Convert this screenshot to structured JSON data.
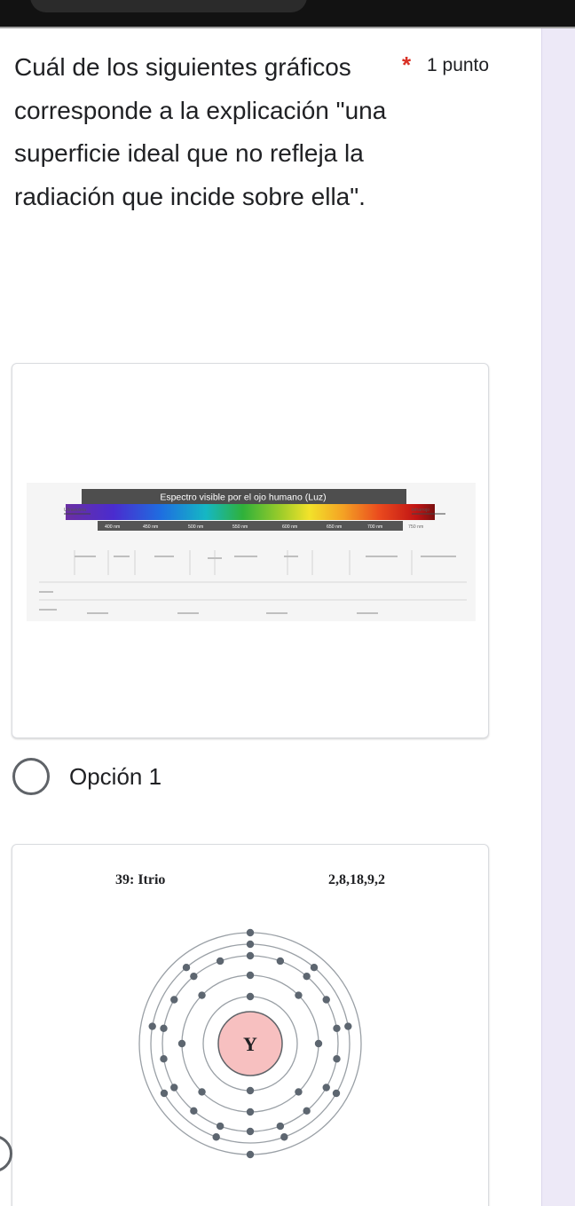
{
  "question": {
    "text": "Cuál de los siguientes gráficos corresponde a la explicación \"una superficie ideal que no refleja la radiación que incide sobre ella\".",
    "required_mark": "*",
    "points": "1 punto"
  },
  "spectrum": {
    "title": "Espectro visible por el ojo humano (Luz)",
    "left_label": "Ultravioleta",
    "right_label": "Infrarrojo",
    "wavelength_ticks": [
      "400 nm",
      "450 nm",
      "500 nm",
      "550 nm",
      "600 nm",
      "650 nm",
      "700 nm",
      "750 nm"
    ]
  },
  "options": [
    {
      "label": "Opción 1"
    }
  ],
  "atom": {
    "title": "39: Itrio",
    "configuration": "2,8,18,9,2",
    "symbol": "Y",
    "shells": [
      2,
      8,
      18,
      9,
      2
    ],
    "colors": {
      "nucleus": "#f7c0c0",
      "electron": "#5d6670",
      "orbit": "#9aa0a6"
    }
  }
}
